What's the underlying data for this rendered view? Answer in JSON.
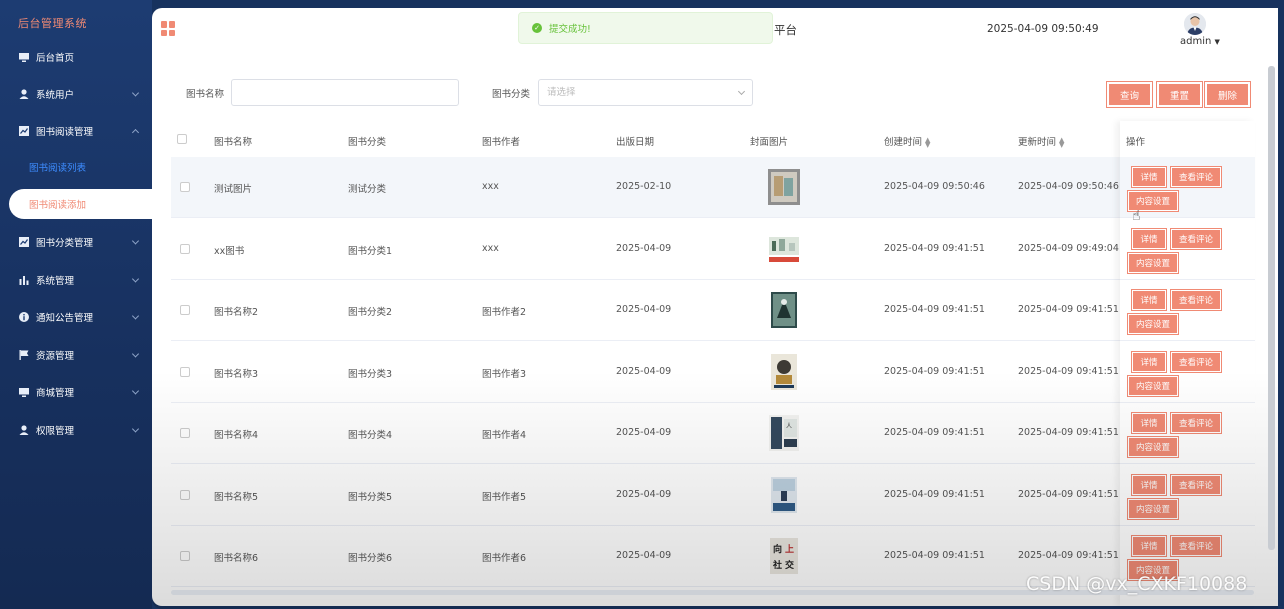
{
  "sidebar": {
    "brand": "后台管理系统",
    "items": [
      {
        "label": "后台首页",
        "icon": "monitor-icon"
      },
      {
        "label": "系统用户",
        "icon": "user-icon"
      },
      {
        "label": "图书阅读管理",
        "icon": "chart-icon"
      },
      {
        "label": "图书阅读列表"
      },
      {
        "label": "图书阅读添加"
      },
      {
        "label": "图书分类管理",
        "icon": "chart-icon"
      },
      {
        "label": "系统管理",
        "icon": "bar-chart-icon"
      },
      {
        "label": "通知公告管理",
        "icon": "info-icon"
      },
      {
        "label": "资源管理",
        "icon": "flag-icon"
      },
      {
        "label": "商城管理",
        "icon": "monitor-icon"
      },
      {
        "label": "权限管理",
        "icon": "user-icon"
      }
    ]
  },
  "header": {
    "title": "平台",
    "datetime": "2025-04-09 09:50:49",
    "user": "admin"
  },
  "toast": {
    "message": "提交成功!"
  },
  "search": {
    "name_label": "图书名称",
    "name_value": "",
    "category_label": "图书分类",
    "category_placeholder": "请选择",
    "query": "查询",
    "reset": "重置",
    "delete": "删除"
  },
  "table": {
    "headers": [
      "图书名称",
      "图书分类",
      "图书作者",
      "出版日期",
      "封面图片",
      "创建时间",
      "更新时间",
      "操作"
    ],
    "rows": [
      {
        "name": "测试图片",
        "category": "测试分类",
        "author": "xxx",
        "date": "2025-02-10",
        "created": "2025-04-09 09:50:46",
        "updated": "2025-04-09 09:50:46"
      },
      {
        "name": "xx图书",
        "category": "图书分类1",
        "author": "xxx",
        "date": "2025-04-09",
        "created": "2025-04-09 09:41:51",
        "updated": "2025-04-09 09:49:04"
      },
      {
        "name": "图书名称2",
        "category": "图书分类2",
        "author": "图书作者2",
        "date": "2025-04-09",
        "created": "2025-04-09 09:41:51",
        "updated": "2025-04-09 09:41:51"
      },
      {
        "name": "图书名称3",
        "category": "图书分类3",
        "author": "图书作者3",
        "date": "2025-04-09",
        "created": "2025-04-09 09:41:51",
        "updated": "2025-04-09 09:41:51"
      },
      {
        "name": "图书名称4",
        "category": "图书分类4",
        "author": "图书作者4",
        "date": "2025-04-09",
        "created": "2025-04-09 09:41:51",
        "updated": "2025-04-09 09:41:51"
      },
      {
        "name": "图书名称5",
        "category": "图书分类5",
        "author": "图书作者5",
        "date": "2025-04-09",
        "created": "2025-04-09 09:41:51",
        "updated": "2025-04-09 09:41:51"
      },
      {
        "name": "图书名称6",
        "category": "图书分类6",
        "author": "图书作者6",
        "date": "2025-04-09",
        "created": "2025-04-09 09:41:51",
        "updated": "2025-04-09 09:41:51"
      }
    ],
    "actions": {
      "detail": "详情",
      "comments": "查看评论",
      "content": "内容设置"
    }
  },
  "watermark": "CSDN @vx_CXKF10088",
  "colors": {
    "accent": "#f08a74",
    "sidebar": "#1d3c72",
    "link": "#3d8cff",
    "success": "#67c23a"
  }
}
